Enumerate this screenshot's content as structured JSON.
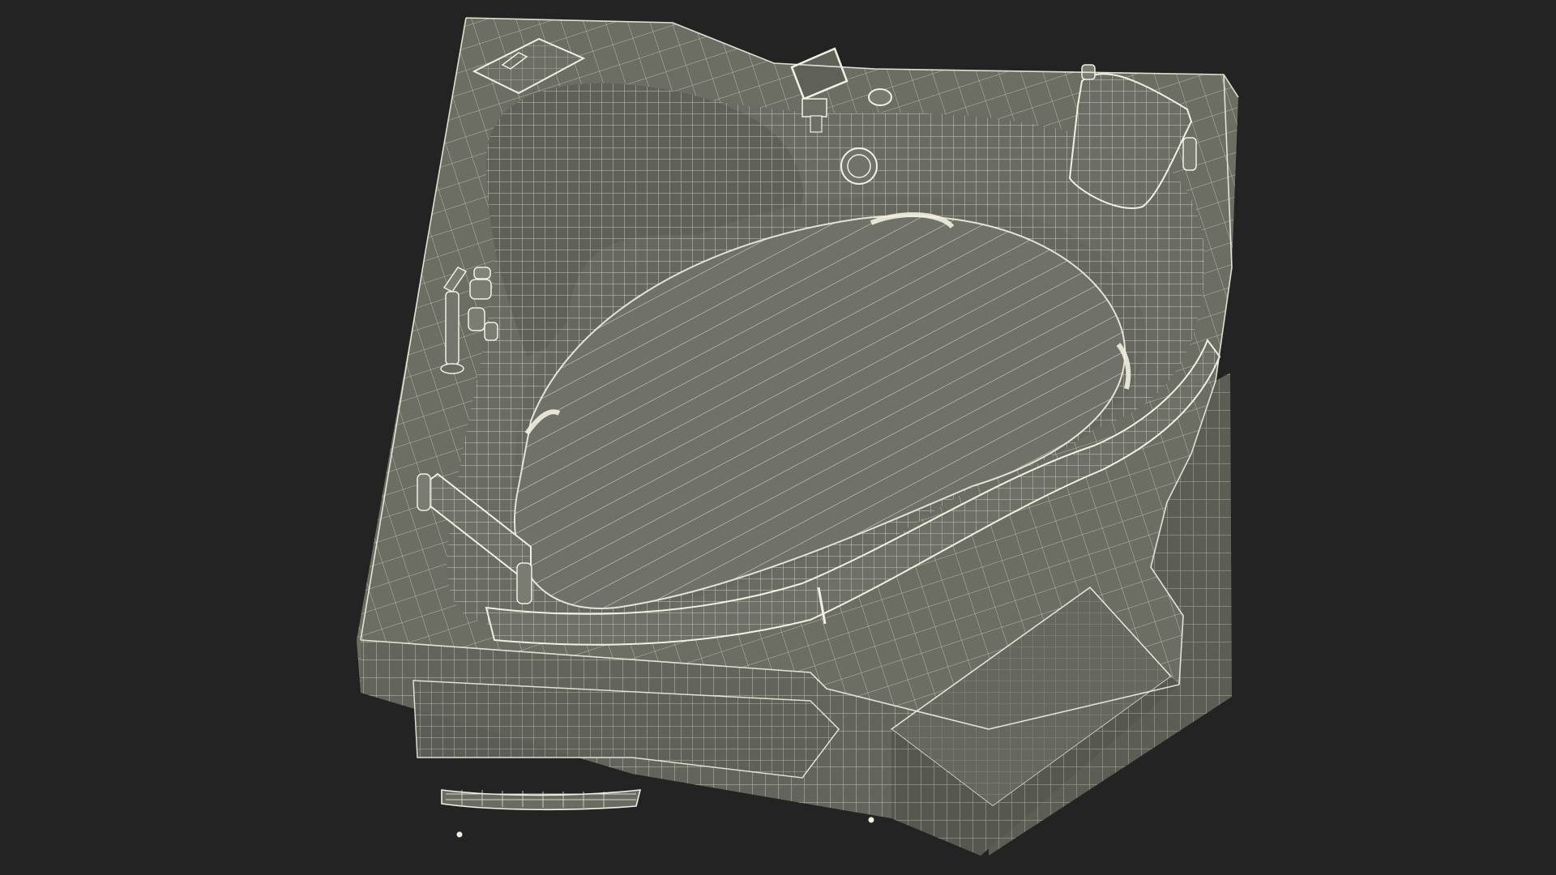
{
  "viewport": {
    "background": "#232323"
  },
  "model": {
    "subject": "corner-whirlpool-bathtub",
    "render_mode": "wireframe",
    "surface_color": "#6c6d63",
    "surface_dark": "#5a5b53",
    "basin_color": "#6f7067",
    "wire_color": "#eae8d6",
    "wire_dense_color": "#f2f0e0",
    "fixtures": [
      "control-panel",
      "soap-tray",
      "faucet-tap",
      "jet-nozzle",
      "headrest-pillow",
      "handrail",
      "apron-grille",
      "step-plinth"
    ]
  }
}
